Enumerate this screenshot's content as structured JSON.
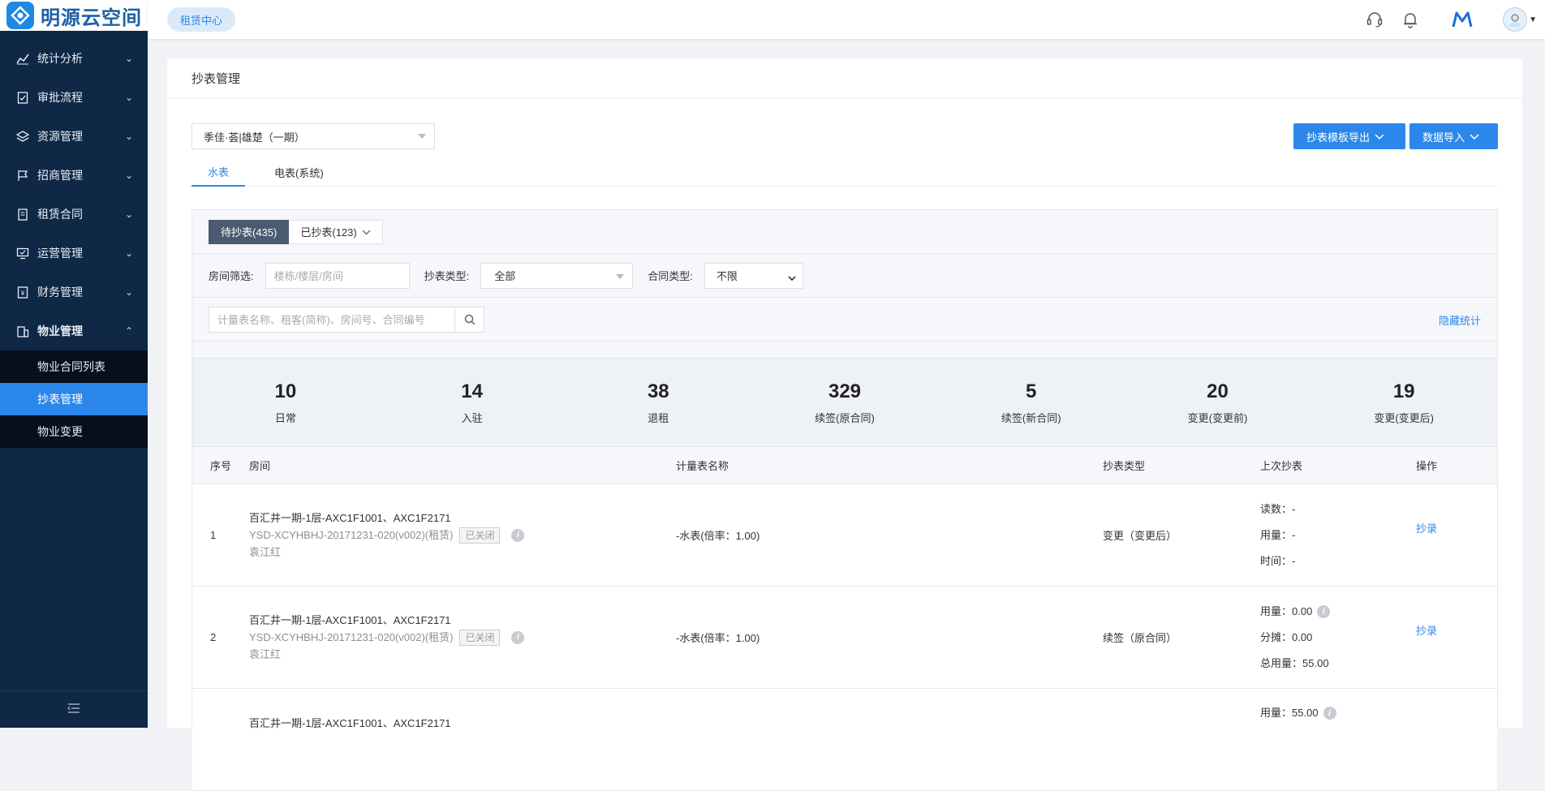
{
  "app": {
    "name": "明源云空间"
  },
  "header": {
    "tag": "租赁中心"
  },
  "sidebar": {
    "items": [
      {
        "label": "统计分析",
        "icon": "chart-icon"
      },
      {
        "label": "审批流程",
        "icon": "clipboard-icon"
      },
      {
        "label": "资源管理",
        "icon": "layers-icon"
      },
      {
        "label": "招商管理",
        "icon": "flag-icon"
      },
      {
        "label": "租赁合同",
        "icon": "document-icon"
      },
      {
        "label": "运营管理",
        "icon": "monitor-icon"
      },
      {
        "label": "财务管理",
        "icon": "finance-icon"
      },
      {
        "label": "物业管理",
        "icon": "building-icon"
      }
    ],
    "sub_items": [
      {
        "label": "物业合同列表"
      },
      {
        "label": "抄表管理"
      },
      {
        "label": "物业变更"
      }
    ]
  },
  "page": {
    "title": "抄表管理",
    "project_select": "季佳·荟|雄楚（一期）",
    "export_button": "抄表模板导出",
    "import_button": "数据导入",
    "tabs": [
      {
        "label": "水表"
      },
      {
        "label": "电表(系统)"
      }
    ],
    "toggle": {
      "pending": "待抄表(435)",
      "done": "已抄表(123)"
    },
    "filters": {
      "room_label": "房间筛选:",
      "room_placeholder": "楼栋/楼层/房间",
      "type_label": "抄表类型:",
      "type_value": "全部",
      "contract_label": "合同类型:",
      "contract_value": "不限"
    },
    "search_placeholder": "计量表名称、租客(简称)、房间号、合同编号",
    "hide_stats": "隐藏统计",
    "stats": [
      {
        "value": "10",
        "label": "日常"
      },
      {
        "value": "14",
        "label": "入驻"
      },
      {
        "value": "38",
        "label": "退租"
      },
      {
        "value": "329",
        "label": "续签(原合同)"
      },
      {
        "value": "5",
        "label": "续签(新合同)"
      },
      {
        "value": "20",
        "label": "变更(变更前)"
      },
      {
        "value": "19",
        "label": "变更(变更后)"
      }
    ],
    "columns": {
      "no": "序号",
      "room": "房间",
      "meter": "计量表名称",
      "type": "抄表类型",
      "last": "上次抄表",
      "op": "操作"
    },
    "rows": [
      {
        "no": "1",
        "room": "百汇井一期-1层-AXC1F1001、AXC1F2171",
        "code": "YSD-XCYHBHJ-20171231-020(v002)(租赁)",
        "status": "已关闭",
        "owner": "袁江红",
        "meter": "-水表(倍率：1.00)",
        "type": "变更（变更后）",
        "last": [
          {
            "k": "读数：",
            "v": "-"
          },
          {
            "k": "用量：",
            "v": "-"
          },
          {
            "k": "时间：",
            "v": "-"
          }
        ],
        "op": "抄录"
      },
      {
        "no": "2",
        "room": "百汇井一期-1层-AXC1F1001、AXC1F2171",
        "code": "YSD-XCYHBHJ-20171231-020(v002)(租赁)",
        "status": "已关闭",
        "owner": "袁江红",
        "meter": "-水表(倍率：1.00)",
        "type": "续签（原合同）",
        "last": [
          {
            "k": "用量：",
            "v": "0.00"
          },
          {
            "k": "分摊：",
            "v": "0.00"
          },
          {
            "k": "总用量：",
            "v": "55.00"
          }
        ],
        "op": "抄录"
      },
      {
        "no": "",
        "room": "百汇井一期-1层-AXC1F1001、AXC1F2171",
        "last": [
          {
            "k": "用量：",
            "v": "55.00"
          }
        ]
      }
    ]
  }
}
